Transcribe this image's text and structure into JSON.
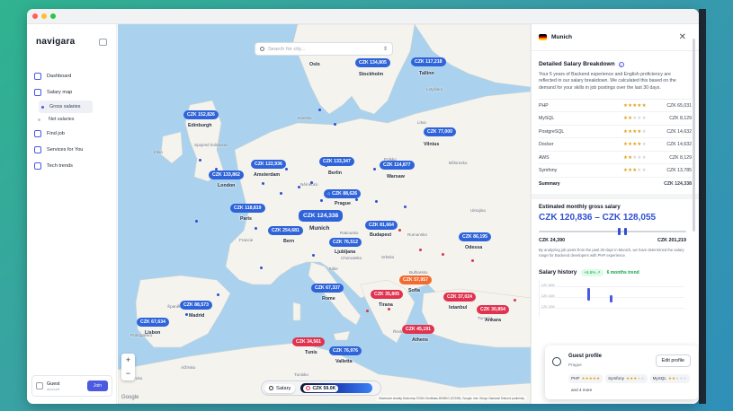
{
  "sidebar": {
    "logo": "navigara",
    "nav": [
      {
        "label": "Dashboard",
        "icon": "dashboard-icon"
      },
      {
        "label": "Salary map",
        "icon": "map-icon"
      },
      {
        "label": "Find job",
        "icon": "briefcase-icon"
      },
      {
        "label": "Services for You",
        "icon": "services-icon"
      },
      {
        "label": "Tech trends",
        "icon": "trends-icon"
      }
    ],
    "sub_items": [
      "Gross salaries",
      "Net salaries"
    ],
    "guest": {
      "name": "Guest",
      "sub": "account",
      "join": "Join"
    }
  },
  "map": {
    "search_placeholder": "Search for city...",
    "pins": [
      {
        "label": "CZK 134,805",
        "color": "blue"
      },
      {
        "label": "CZK 117,218",
        "color": "blue"
      },
      {
        "label": "CZK 152,826",
        "color": "blue"
      },
      {
        "label": "CZK 77,000",
        "color": "blue"
      },
      {
        "label": "CZK 133,347",
        "color": "blue"
      },
      {
        "label": "CZK 114,877",
        "color": "blue"
      },
      {
        "label": "CZK 122,936",
        "color": "blue"
      },
      {
        "label": "CZK 133,862",
        "color": "blue"
      },
      {
        "label": "CZK 88,626",
        "color": "blue"
      },
      {
        "label": "CZK 118,819",
        "color": "blue"
      },
      {
        "label": "CZK 124,338",
        "color": "blue"
      },
      {
        "label": "CZK 81,664",
        "color": "blue"
      },
      {
        "label": "CZK 254,681",
        "color": "blue"
      },
      {
        "label": "CZK 76,512",
        "color": "blue"
      },
      {
        "label": "CZK 86,195",
        "color": "blue"
      },
      {
        "label": "CZK 57,957",
        "color": "orange"
      },
      {
        "label": "CZK 67,337",
        "color": "blue"
      },
      {
        "label": "CZK 35,805",
        "color": "red"
      },
      {
        "label": "CZK 37,024",
        "color": "red"
      },
      {
        "label": "CZK 88,573",
        "color": "blue"
      },
      {
        "label": "CZK 30,854",
        "color": "red"
      },
      {
        "label": "CZK 67,634",
        "color": "blue"
      },
      {
        "label": "CZK 45,191",
        "color": "red"
      },
      {
        "label": "CZK 34,561",
        "color": "red"
      },
      {
        "label": "CZK 76,976",
        "color": "blue"
      }
    ],
    "cities": [
      "Oslo",
      "Stockholm",
      "Tallinn",
      "Edinburgh",
      "Vilnius",
      "Berlin",
      "Warsaw",
      "Amsterdam",
      "London",
      "Prague",
      "Paris",
      "Munich",
      "Budapest",
      "Bern",
      "Ljubljana",
      "Odessa",
      "Sofia",
      "Rome",
      "Tirana",
      "Istanbul",
      "Madrid",
      "Ankara",
      "Lisbon",
      "Athens",
      "Tunis",
      "Valletta"
    ],
    "minor_labels": [
      "Lotyšsko",
      "Litva",
      "Bělorusko",
      "Ukrajina",
      "Německo",
      "Francie",
      "Itálie",
      "Rumunsko",
      "Srbsko",
      "Moldavsko",
      "Slovensko",
      "Rakousko",
      "Španělsko",
      "Portugalsko",
      "Turecko",
      "Řecko",
      "Polsko",
      "Spojené království",
      "Dánsko",
      "Irsko",
      "Chorvatsko",
      "Bulharsko",
      "Alžírsko",
      "Maroko",
      "Tunisko"
    ],
    "zoom_in": "+",
    "zoom_out": "−",
    "google": "Google",
    "attribution": "Klávesové zkratky   Data map ©2024 GeoBasis-DE/BKG (©2009), Google, Inst. Geogr. Nacional   Smluvní podmínky",
    "toggle": {
      "label": "Salary",
      "legend": "CZK 59.0K"
    }
  },
  "panel": {
    "city": "Munich",
    "breakdown_title": "Detailed Salary Breakdown",
    "description": "Your 5 years of Backend experience and English proficiency are reflected in our salary breakdown. We calculated this based on the demand for your skills in job postings over the last 30 days.",
    "skills": [
      {
        "name": "PHP",
        "stars": 5,
        "value": "CZK 65,031"
      },
      {
        "name": "MySQL",
        "stars": 2,
        "value": "CZK 8,129"
      },
      {
        "name": "PostgreSQL",
        "stars": 4,
        "value": "CZK 14,632"
      },
      {
        "name": "Docker",
        "stars": 4,
        "value": "CZK 14,632"
      },
      {
        "name": "AWS",
        "stars": 2,
        "value": "CZK 8,129"
      },
      {
        "name": "Symfony",
        "stars": 3,
        "value": "CZK 13,785"
      }
    ],
    "summary": {
      "label": "Summary",
      "value": "CZK 124,338"
    },
    "estimate_title": "Estimated monthly gross salary",
    "estimate_range": "CZK 120,836 – CZK 128,055",
    "slider": {
      "min_label": "CZK 24,390",
      "max_label": "CZK 201,219",
      "low": 120836,
      "high": 128055,
      "min": 24390,
      "max": 201219
    },
    "estimate_note": "By analyzing job posts from the past 30 days in Munich, we have determined the salary range for Backend developers with PHP experience.",
    "history_title": "Salary history",
    "trend_badge": "+6.6% ↗",
    "trend_label": "6 months trend",
    "history_axis": [
      "CZK 160K",
      "CZK 140K",
      "CZK 120K"
    ],
    "profile": {
      "title": "Guest profile",
      "location": "Prague",
      "edit": "Edit profile",
      "chips": [
        {
          "name": "PHP",
          "stars": 5
        },
        {
          "name": "Symfony",
          "stars": 3
        },
        {
          "name": "MySQL",
          "stars": 2
        }
      ],
      "more": "and 4 more"
    }
  },
  "colors": {
    "accent": "#4b5ae0",
    "pin_blue": "#2e63d9",
    "pin_red": "#e0334f",
    "pin_orange": "#f26a2d",
    "star": "#e0a21b",
    "trend_green": "#16a34a"
  }
}
